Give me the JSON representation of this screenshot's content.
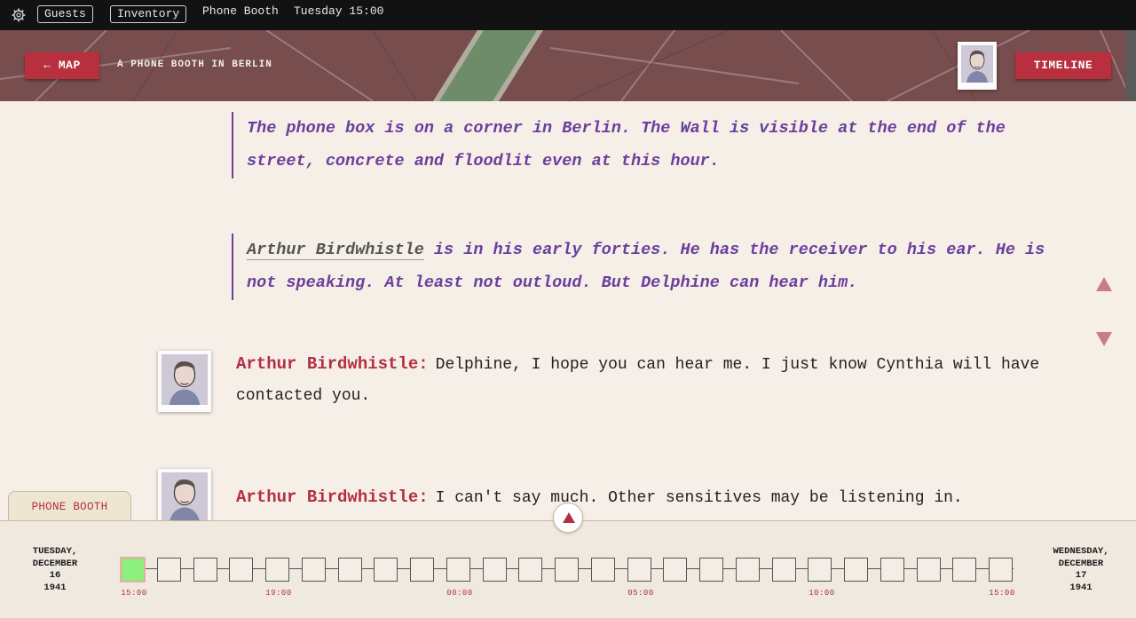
{
  "topbar": {
    "settings_icon": "gear-icon",
    "guests_label": "Guests",
    "inventory_label": "Inventory",
    "location": "Phone Booth",
    "time": "Tuesday 15:00"
  },
  "header": {
    "map_button": "← MAP",
    "location_title": "A PHONE BOOTH IN BERLIN",
    "timeline_button": "TIMELINE"
  },
  "transcript": {
    "narration1": "The phone box is on a corner in Berlin. The Wall is visible at the end of the street, concrete and floodlit even at this hour.",
    "narration2_name": "Arthur Birdwhistle",
    "narration2_rest": " is in his early forties. He has the receiver to his ear. He is not speaking. At least not outloud. But Delphine can hear him.",
    "line1_speaker": "Arthur Birdwhistle:",
    "line1_text": "Delphine, I hope you can hear me. I just know Cynthia will have contacted you.",
    "line2_speaker": "Arthur Birdwhistle:",
    "line2_text": "I can't say much. Other sensitives may be listening in."
  },
  "timeline": {
    "tab_label": "PHONE BOOTH",
    "start_date": [
      "TUESDAY,",
      "DECEMBER",
      "16",
      "1941"
    ],
    "end_date": [
      "WEDNESDAY,",
      "DECEMBER",
      "17",
      "1941"
    ],
    "active_label": "15:00",
    "tick_labels": [
      "19:00",
      "00:00",
      "05:00",
      "10:00",
      "15:00"
    ],
    "slot_count": 25,
    "active_slot": 0
  },
  "colors": {
    "accent_red": "#b8303e",
    "narration_purple": "#6b3f9d",
    "active_slot_green": "#8ef07c"
  }
}
